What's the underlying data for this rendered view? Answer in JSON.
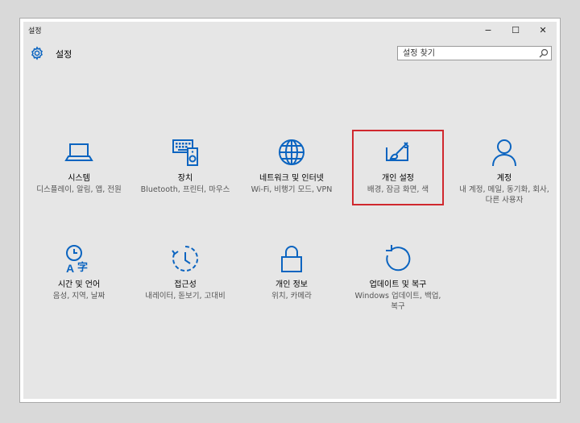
{
  "window": {
    "title": "설정",
    "app_title": "설정",
    "controls": {
      "minimize": "−",
      "maximize": "☐",
      "close": "✕"
    }
  },
  "search": {
    "placeholder": "설정 찾기",
    "value": ""
  },
  "tiles": [
    {
      "name": "시스템",
      "desc": "디스플레이, 알림, 앱, 전원",
      "icon": "laptop-icon"
    },
    {
      "name": "장치",
      "desc": "Bluetooth, 프린터, 마우스",
      "icon": "devices-icon"
    },
    {
      "name": "네트워크 및 인터넷",
      "desc": "Wi-Fi, 비행기 모드, VPN",
      "icon": "globe-icon"
    },
    {
      "name": "개인 설정",
      "desc": "배경, 잠금 화면, 색",
      "icon": "paintbrush-icon",
      "highlighted": true
    },
    {
      "name": "계정",
      "desc": "내 계정, 메일, 동기화, 회사, 다른 사용자",
      "icon": "person-icon"
    },
    {
      "name": "시간 및 언어",
      "desc": "음성, 지역, 날짜",
      "icon": "time-language-icon"
    },
    {
      "name": "접근성",
      "desc": "내레이터, 돋보기, 고대비",
      "icon": "ease-of-access-icon"
    },
    {
      "name": "개인 정보",
      "desc": "위치, 카메라",
      "icon": "lock-icon"
    },
    {
      "name": "업데이트 및 복구",
      "desc": "Windows 업데이트, 백업, 복구",
      "icon": "refresh-icon"
    }
  ],
  "colors": {
    "accent": "#0b64c0",
    "highlight_border": "#d0282e",
    "background": "#e6e6e6"
  }
}
